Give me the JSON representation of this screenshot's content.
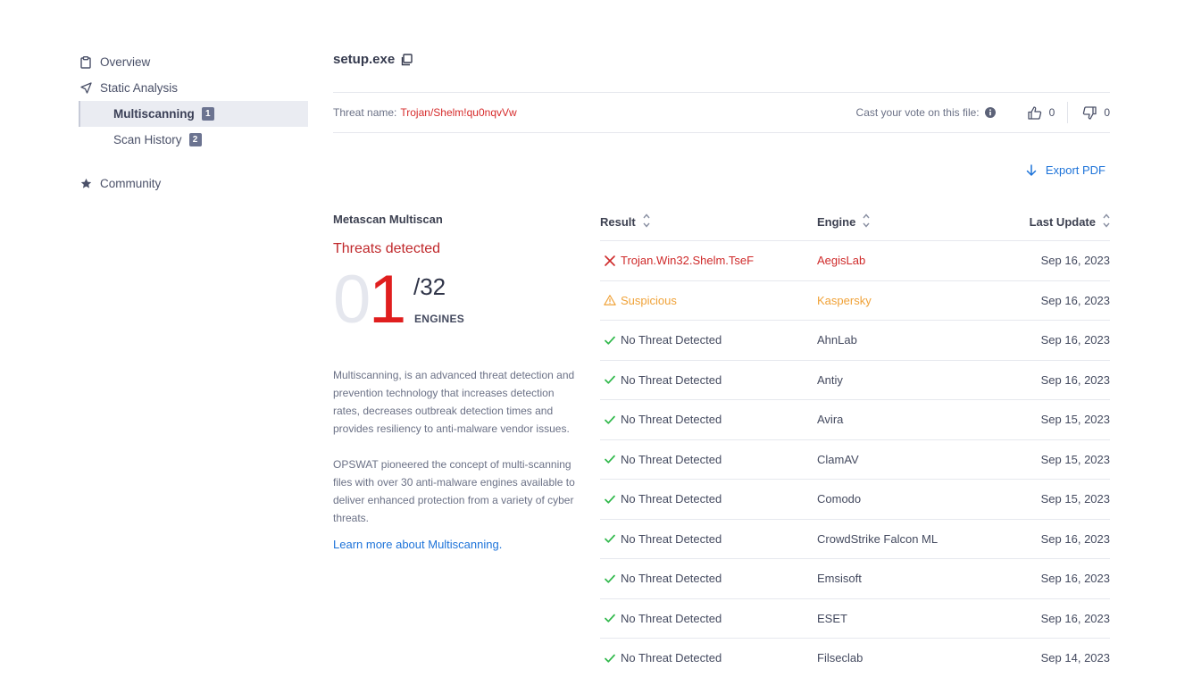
{
  "sidebar": {
    "items": [
      {
        "label": "Overview",
        "icon": "clipboard-icon"
      },
      {
        "label": "Static Analysis",
        "icon": "send-icon"
      },
      {
        "label": "Multiscanning",
        "badge": "1",
        "active": true
      },
      {
        "label": "Scan History",
        "badge": "2"
      },
      {
        "label": "Community",
        "icon": "star-icon"
      }
    ]
  },
  "header": {
    "file_name": "setup.exe",
    "threat_label": "Threat name:",
    "threat_value": "Trojan/Shelm!qu0nqvVw",
    "vote_label": "Cast your vote on this file:",
    "upvotes": "0",
    "downvotes": "0"
  },
  "actions": {
    "export_label": "Export PDF"
  },
  "summary": {
    "engine_name": "Metascan Multiscan",
    "verdict": "Threats detected",
    "score_zero": "0",
    "score_detected": "1",
    "score_total": "/32",
    "engines_label": "ENGINES",
    "paragraph1": "Multiscanning, is an advanced threat detection and prevention technology that increases detection rates, decreases outbreak detection times and provides resiliency to anti-malware vendor issues.",
    "paragraph2": "OPSWAT pioneered the concept of multi-scanning files with over 30 anti-malware engines available to deliver enhanced protection from a variety of cyber threats.",
    "learn_more": "Learn more about Multiscanning."
  },
  "table": {
    "headers": {
      "result": "Result",
      "engine": "Engine",
      "date": "Last Update"
    },
    "rows": [
      {
        "status": "threat",
        "result": "Trojan.Win32.Shelm.TseF",
        "engine": "AegisLab",
        "date": "Sep 16, 2023"
      },
      {
        "status": "suspicious",
        "result": "Suspicious",
        "engine": "Kaspersky",
        "date": "Sep 16, 2023"
      },
      {
        "status": "clean",
        "result": "No Threat Detected",
        "engine": "AhnLab",
        "date": "Sep 16, 2023"
      },
      {
        "status": "clean",
        "result": "No Threat Detected",
        "engine": "Antiy",
        "date": "Sep 16, 2023"
      },
      {
        "status": "clean",
        "result": "No Threat Detected",
        "engine": "Avira",
        "date": "Sep 15, 2023"
      },
      {
        "status": "clean",
        "result": "No Threat Detected",
        "engine": "ClamAV",
        "date": "Sep 15, 2023"
      },
      {
        "status": "clean",
        "result": "No Threat Detected",
        "engine": "Comodo",
        "date": "Sep 15, 2023"
      },
      {
        "status": "clean",
        "result": "No Threat Detected",
        "engine": "CrowdStrike Falcon ML",
        "date": "Sep 16, 2023"
      },
      {
        "status": "clean",
        "result": "No Threat Detected",
        "engine": "Emsisoft",
        "date": "Sep 16, 2023"
      },
      {
        "status": "clean",
        "result": "No Threat Detected",
        "engine": "ESET",
        "date": "Sep 16, 2023"
      },
      {
        "status": "clean",
        "result": "No Threat Detected",
        "engine": "Filseclab",
        "date": "Sep 14, 2023"
      }
    ]
  },
  "colors": {
    "threat": "#cf2a2a",
    "suspicious": "#f0a238",
    "clean": "#2fb84a",
    "link": "#1d73d9"
  }
}
